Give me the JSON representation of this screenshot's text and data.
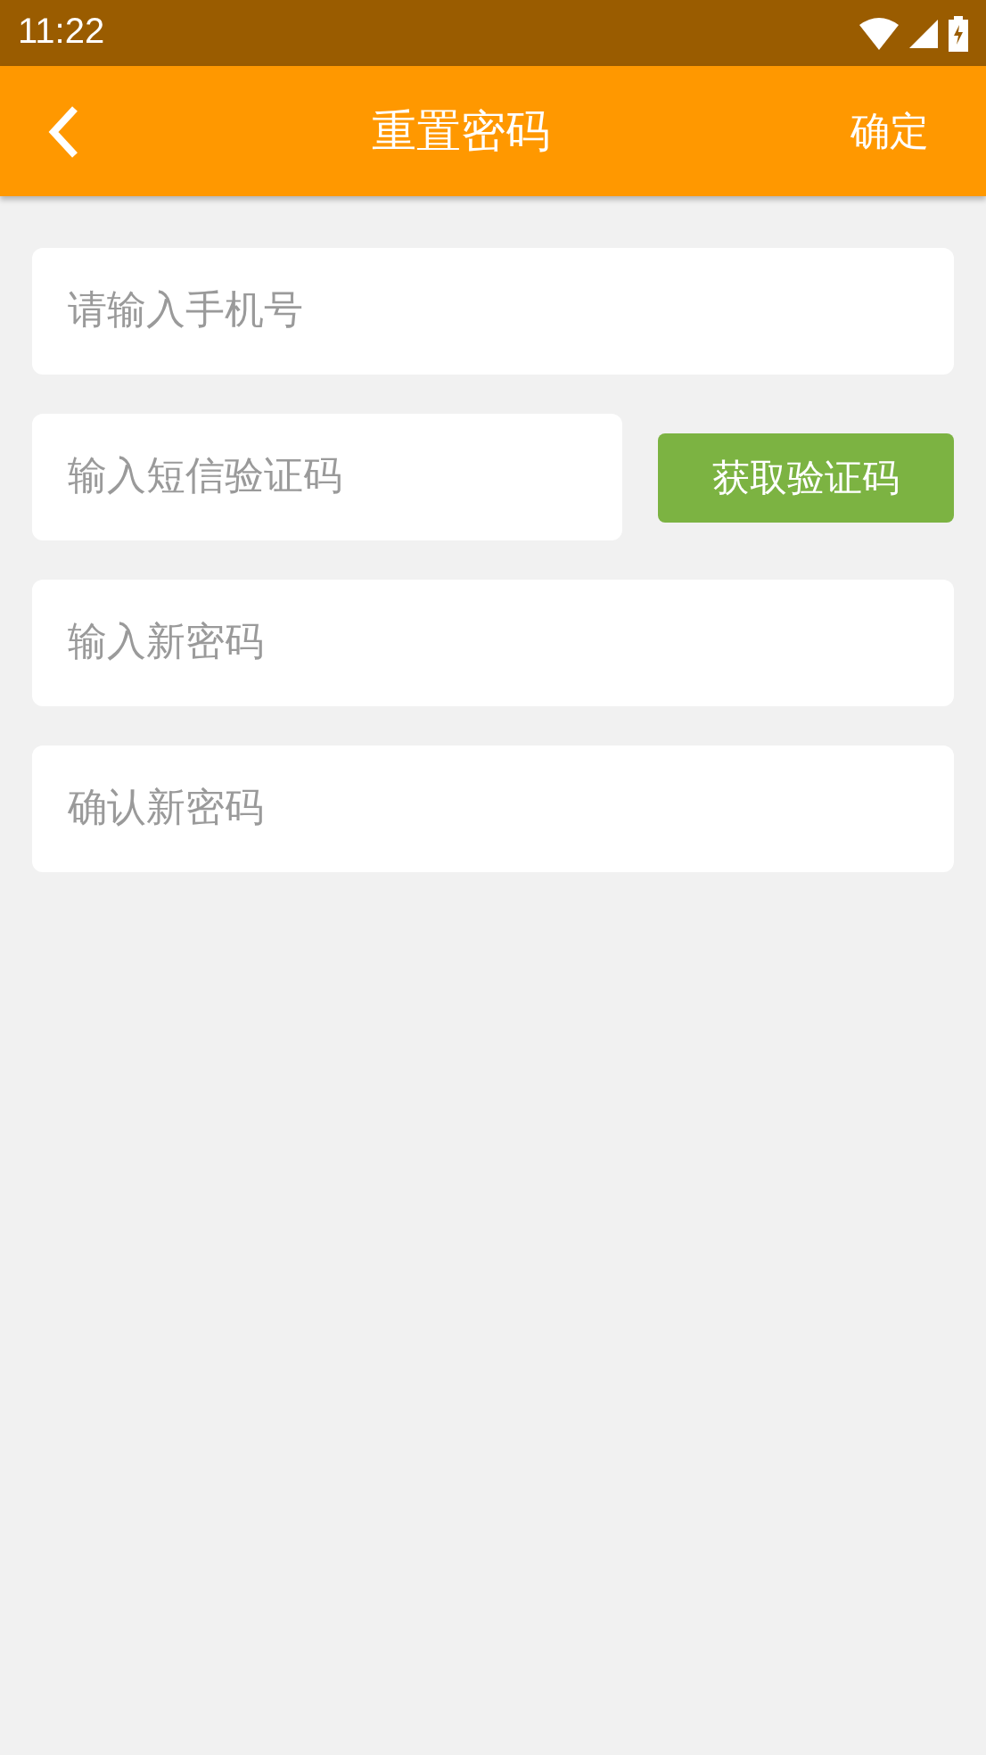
{
  "status_bar": {
    "time": "11:22"
  },
  "header": {
    "title": "重置密码",
    "action": "确定"
  },
  "fields": [
    {
      "kind": "plain",
      "placeholder": "请输入手机号"
    },
    {
      "kind": "code",
      "placeholder": "输入短信验证码",
      "button": "获取验证码"
    },
    {
      "kind": "plain",
      "placeholder": "输入新密码"
    },
    {
      "kind": "plain",
      "placeholder": "确认新密码"
    }
  ]
}
